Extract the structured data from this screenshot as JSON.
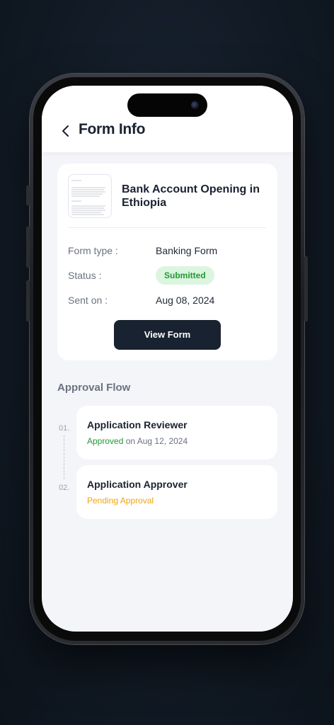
{
  "header": {
    "title": "Form Info",
    "back_icon": "chevron-left-icon"
  },
  "form_card": {
    "document_title": "Bank Account Opening in Ethiopia",
    "thumbnail_icon": "document-thumbnail",
    "fields": [
      {
        "label": "Form type :",
        "value": "Banking Form"
      },
      {
        "label": "Status :",
        "value": "Submitted"
      },
      {
        "label": "Sent on :",
        "value": "Aug 08, 2024"
      }
    ],
    "status_color": "#1f9a34",
    "view_button_label": "View Form"
  },
  "approval_flow": {
    "title": "Approval Flow",
    "steps": [
      {
        "number": "01.",
        "title": "Application Reviewer",
        "status": "Approved",
        "status_suffix": "on Aug 12, 2024",
        "status_color": "#1f9a34"
      },
      {
        "number": "02.",
        "title": "Application Approver",
        "status": "Pending Approval",
        "status_suffix": "",
        "status_color": "#f0a50e"
      }
    ]
  },
  "colors": {
    "accent_dark": "#182230",
    "background": "#f4f5f8"
  }
}
